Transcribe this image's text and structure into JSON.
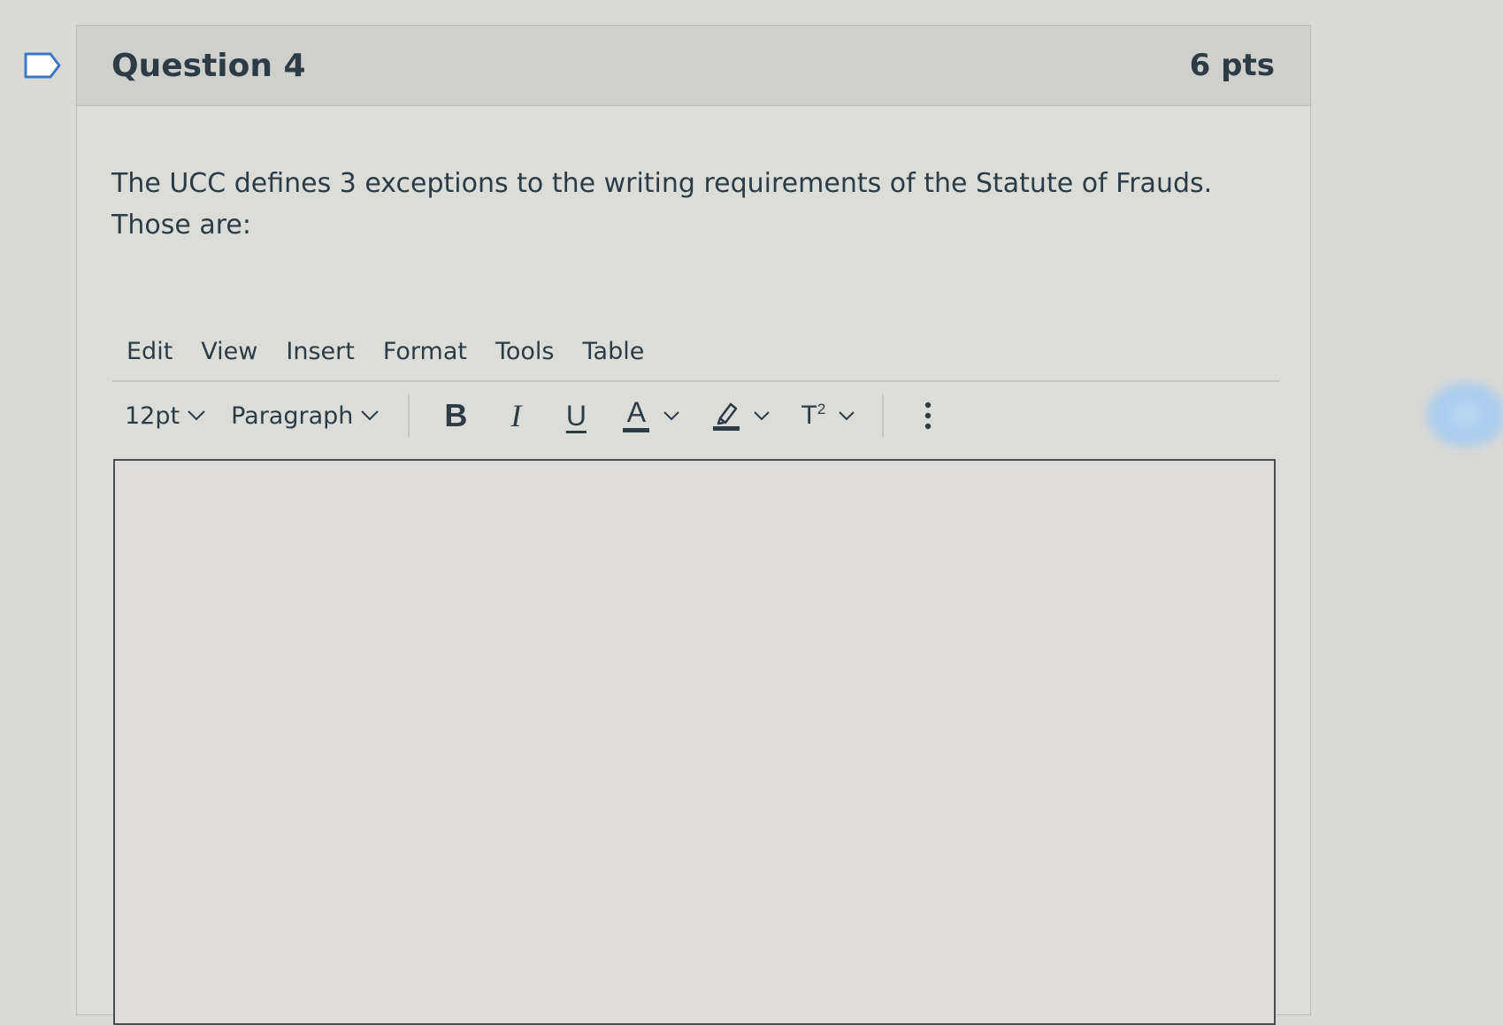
{
  "question": {
    "title": "Question 4",
    "points": "6 pts",
    "text": "The UCC defines 3 exceptions to the writing requirements of the Statute of Frauds. Those are:"
  },
  "editor": {
    "menubar": [
      "Edit",
      "View",
      "Insert",
      "Format",
      "Tools",
      "Table"
    ],
    "toolbar": {
      "font_size": "12pt",
      "block_format": "Paragraph",
      "bold_label": "B",
      "italic_label": "I",
      "underline_label": "U",
      "text_color_label": "A",
      "superscript_label": "T",
      "superscript_mark": "2"
    },
    "content": ""
  },
  "icons": {
    "flag": "flag-question-icon",
    "more": "more-vertical-icon",
    "highlight": "highlight-color-icon"
  },
  "colors": {
    "text": "#2d3b45",
    "header_bg": "#cfcfcc",
    "border": "#494c50"
  }
}
